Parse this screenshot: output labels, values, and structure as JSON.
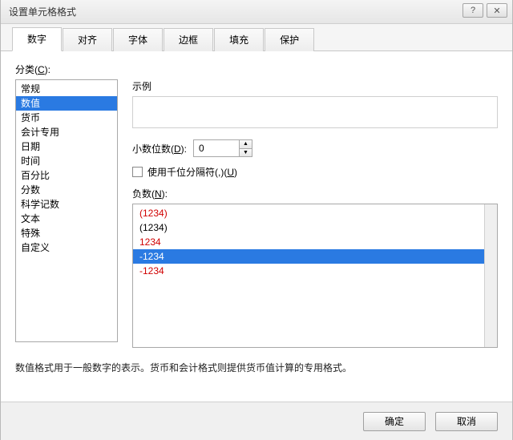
{
  "window": {
    "title": "设置单元格格式",
    "help_glyph": "?",
    "close_glyph": "✕"
  },
  "tabs": [
    "数字",
    "对齐",
    "字体",
    "边框",
    "填充",
    "保护"
  ],
  "tabs_active_index": 0,
  "category": {
    "label_prefix": "分类(",
    "label_hotkey": "C",
    "label_suffix": "):",
    "items": [
      "常规",
      "数值",
      "货币",
      "会计专用",
      "日期",
      "时间",
      "百分比",
      "分数",
      "科学记数",
      "文本",
      "特殊",
      "自定义"
    ],
    "selected_index": 1
  },
  "sample_label": "示例",
  "decimal": {
    "label_prefix": "小数位数(",
    "label_hotkey": "D",
    "label_suffix": "):",
    "value": "0"
  },
  "thousand": {
    "prefix": "使用千位分隔符(,)(",
    "hotkey": "U",
    "suffix": ")",
    "checked": false
  },
  "negative": {
    "label_prefix": "负数(",
    "label_hotkey": "N",
    "label_suffix": "):",
    "items": [
      {
        "text": "(1234)",
        "red": true
      },
      {
        "text": "(1234)",
        "red": false
      },
      {
        "text": "1234",
        "red": true
      },
      {
        "text": "-1234",
        "red": false
      },
      {
        "text": "-1234",
        "red": true
      }
    ],
    "selected_index": 3
  },
  "description": "数值格式用于一般数字的表示。货币和会计格式则提供货币值计算的专用格式。",
  "buttons": {
    "ok": "确定",
    "cancel": "取消"
  }
}
